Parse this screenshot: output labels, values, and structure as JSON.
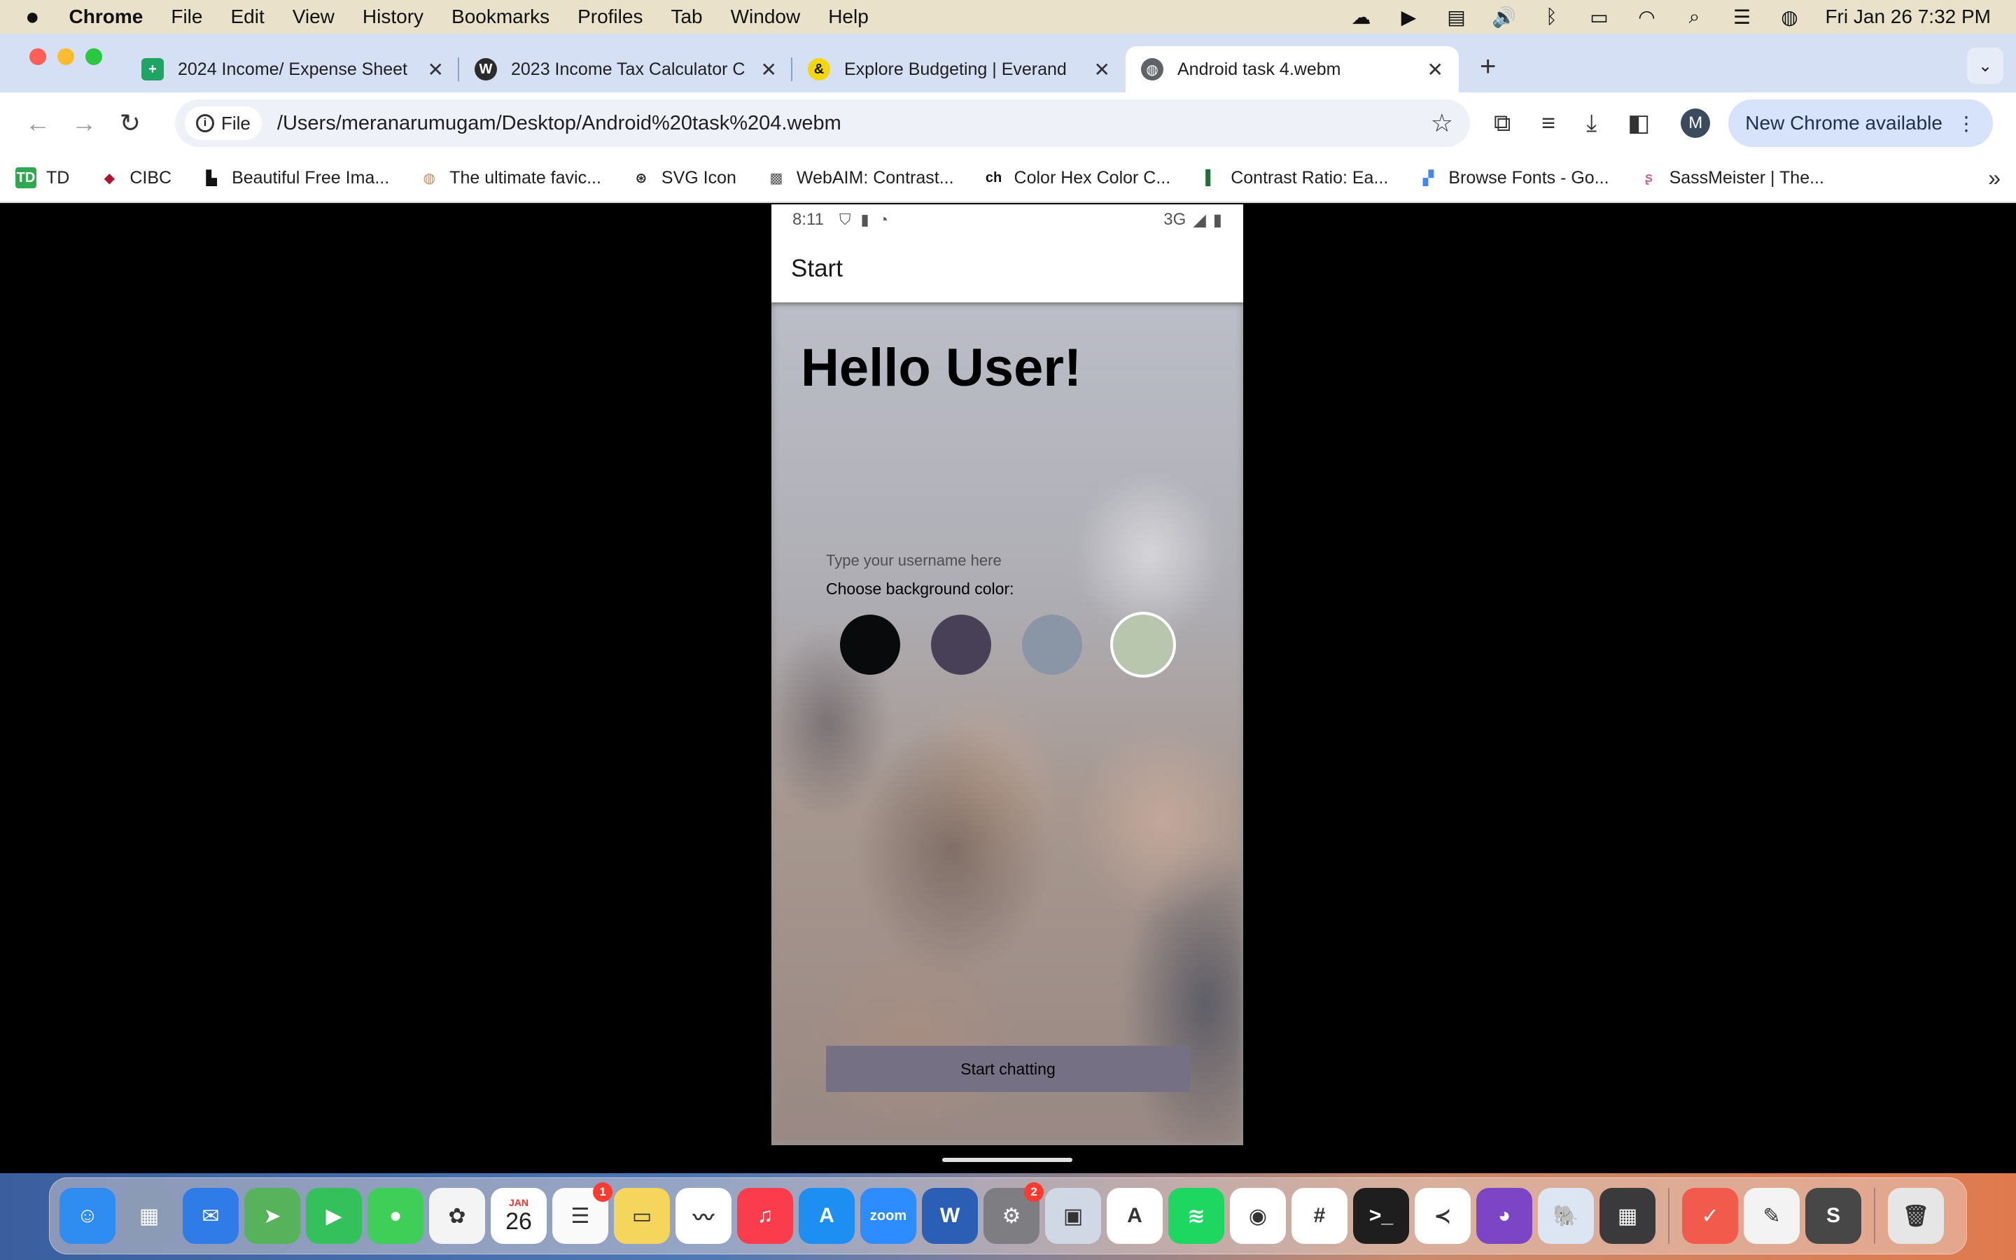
{
  "menubar": {
    "apple": "",
    "app": "Chrome",
    "items": [
      "File",
      "Edit",
      "View",
      "History",
      "Bookmarks",
      "Profiles",
      "Tab",
      "Window",
      "Help"
    ],
    "clock": "Fri Jan 26  7:32 PM"
  },
  "tabs": [
    {
      "title": "2024 Income/ Expense Sheet",
      "favicon": "sheets-icon",
      "color": "#1fa463"
    },
    {
      "title": "2023 Income Tax Calculator C",
      "favicon": "wordpress-icon",
      "color": "#2b2b2b"
    },
    {
      "title": "Explore Budgeting | Everand",
      "favicon": "everand-icon",
      "color": "#f5d60a"
    },
    {
      "title": "Android task 4.webm",
      "favicon": "globe-icon",
      "color": "#5f6368"
    }
  ],
  "toolbar": {
    "chip_label": "File",
    "url": "/Users/meranarumugam/Desktop/Android%20task%204.webm",
    "avatar_initial": "M",
    "update_label": "New Chrome available"
  },
  "bookmarks": [
    {
      "label": "TD",
      "icon": "td-icon",
      "color": "#2fa84f"
    },
    {
      "label": "CIBC",
      "icon": "cibc-icon",
      "color": "#b3132c"
    },
    {
      "label": "Beautiful Free Ima...",
      "icon": "unsplash-icon",
      "color": "#111111"
    },
    {
      "label": "The ultimate favic...",
      "icon": "favicon-icon",
      "color": "#c68a5a"
    },
    {
      "label": "SVG Icon",
      "icon": "svg-icon",
      "color": "#222222"
    },
    {
      "label": "WebAIM: Contrast...",
      "icon": "webaim-icon",
      "color": "#555555"
    },
    {
      "label": "Color Hex Color C...",
      "icon": "colorhex-icon",
      "color": "#111111"
    },
    {
      "label": "Contrast Ratio: Ea...",
      "icon": "contrast-icon",
      "color": "#1f6f3a"
    },
    {
      "label": "Browse Fonts - Go...",
      "icon": "fonts-icon",
      "color": "#4285f4"
    },
    {
      "label": "SassMeister | The...",
      "icon": "sass-icon",
      "color": "#cf649a"
    }
  ],
  "phone": {
    "status_time": "8:11",
    "network": "3G",
    "appbar_title": "Start",
    "greeting": "Hello User!",
    "username_placeholder": "Type your username here",
    "bg_label": "Choose background color:",
    "colors": [
      "#090A0B",
      "#474056",
      "#8A95A5",
      "#B9C6AE"
    ],
    "selected_color_index": 3,
    "start_button": "Start chatting"
  },
  "dock": [
    {
      "name": "finder-icon",
      "color": "#2f8cf0",
      "glyph": "☺"
    },
    {
      "name": "launchpad-icon",
      "color": "#8b9bb5",
      "glyph": "▦"
    },
    {
      "name": "mail-icon",
      "color": "#2f7be8",
      "glyph": "✉"
    },
    {
      "name": "maps-icon",
      "color": "#56b35b",
      "glyph": "➤"
    },
    {
      "name": "facetime-icon",
      "color": "#34c05a",
      "glyph": "▶"
    },
    {
      "name": "messages-icon",
      "color": "#3fcf59",
      "glyph": "●"
    },
    {
      "name": "photos-icon",
      "color": "#f4f4f4",
      "glyph": "✿"
    },
    {
      "name": "calendar-icon",
      "color": "#ffffff",
      "glyph": "26",
      "month": "JAN"
    },
    {
      "name": "reminders-icon",
      "color": "#fafafa",
      "glyph": "☰",
      "badge": "1"
    },
    {
      "name": "notes-icon",
      "color": "#f6d55c",
      "glyph": "▭"
    },
    {
      "name": "freeform-icon",
      "color": "#ffffff",
      "glyph": "〰"
    },
    {
      "name": "music-icon",
      "color": "#fa3c4c",
      "glyph": "♫"
    },
    {
      "name": "appstore-icon",
      "color": "#1d8ff2",
      "glyph": "A"
    },
    {
      "name": "zoom-icon",
      "color": "#2d8cff",
      "glyph": "zoom"
    },
    {
      "name": "word-icon",
      "color": "#2b5fb5",
      "glyph": "W"
    },
    {
      "name": "system-settings-icon",
      "color": "#7d7d82",
      "glyph": "⚙",
      "badge": "2"
    },
    {
      "name": "preview-icon",
      "color": "#cfd8e4",
      "glyph": "▣"
    },
    {
      "name": "xcode-instruments-icon",
      "color": "#ffffff",
      "glyph": "A"
    },
    {
      "name": "spotify-icon",
      "color": "#1ed760",
      "glyph": "≋"
    },
    {
      "name": "chrome-icon",
      "color": "#ffffff",
      "glyph": "◉"
    },
    {
      "name": "slack-icon",
      "color": "#ffffff",
      "glyph": "#"
    },
    {
      "name": "terminal-icon",
      "color": "#1e1e1e",
      "glyph": ">_"
    },
    {
      "name": "vscode-icon",
      "color": "#ffffff",
      "glyph": "≺"
    },
    {
      "name": "github-desktop-icon",
      "color": "#7b45c6",
      "glyph": "◕"
    },
    {
      "name": "postgres-icon",
      "color": "#dce6f2",
      "glyph": "🐘"
    },
    {
      "name": "calculator-icon",
      "color": "#3a3a3c",
      "glyph": "▦"
    },
    {
      "name": "todoist-icon",
      "color": "#f25a4c",
      "glyph": "✓"
    },
    {
      "name": "textedit-icon",
      "color": "#f3f3f3",
      "glyph": "✎"
    },
    {
      "name": "sublime-icon",
      "color": "#474747",
      "glyph": "S"
    },
    {
      "name": "trash-icon",
      "color": "#e6e6e6",
      "glyph": "🗑"
    }
  ]
}
